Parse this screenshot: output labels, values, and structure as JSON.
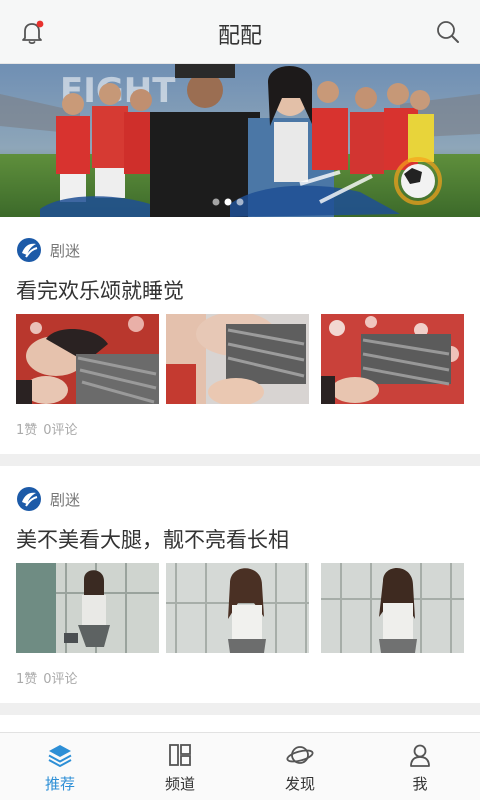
{
  "header": {
    "title": "配配",
    "notification_icon": "bell-icon",
    "notification_badge_color": "#e8322e",
    "search_icon": "search-icon"
  },
  "banner": {
    "text": "FIGHT",
    "pager": {
      "count": 3,
      "active": 1
    }
  },
  "feed": [
    {
      "source": "剧迷",
      "title": "看完欢乐颂就睡觉",
      "likes": "1赞",
      "comments": "0评论",
      "images": [
        "photo-1",
        "photo-2",
        "photo-3"
      ]
    },
    {
      "source": "剧迷",
      "title": "美不美看大腿，靓不亮看长相",
      "likes": "1赞",
      "comments": "0评论",
      "images": [
        "photo-1",
        "photo-2",
        "photo-3"
      ]
    }
  ],
  "tabbar": {
    "active_color": "#2d8fd6",
    "items": [
      {
        "label": "推荐",
        "icon": "layers-icon"
      },
      {
        "label": "频道",
        "icon": "channels-grid-icon"
      },
      {
        "label": "发现",
        "icon": "planet-icon"
      },
      {
        "label": "我",
        "icon": "user-icon"
      }
    ]
  }
}
